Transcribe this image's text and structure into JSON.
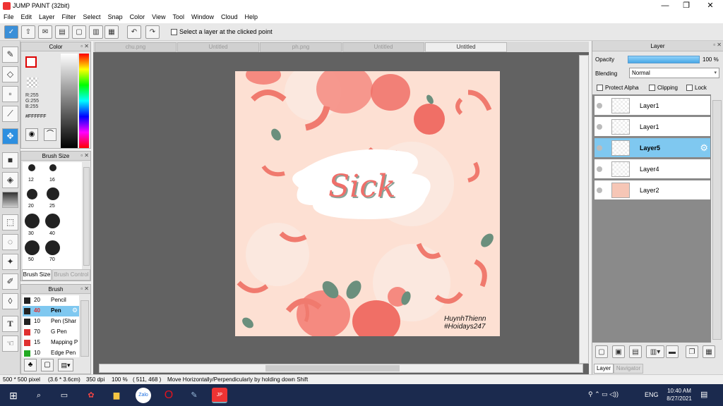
{
  "window": {
    "title": "JUMP PAINT (32bit)",
    "minimize": "—",
    "restore": "❐",
    "close": "✕"
  },
  "menu": [
    "File",
    "Edit",
    "Layer",
    "Filter",
    "Select",
    "Snap",
    "Color",
    "View",
    "Tool",
    "Window",
    "Cloud",
    "Help"
  ],
  "toolbar": {
    "select_layer_label": "Select a layer at the clicked point"
  },
  "color_panel": {
    "title": "Color",
    "r": "R:255",
    "g": "G:255",
    "b": "B:255",
    "hex": "#FFFFFF"
  },
  "brush_size_panel": {
    "title": "Brush Size",
    "sizes": [
      "12",
      "16",
      "20",
      "25",
      "30",
      "40",
      "50",
      "70"
    ],
    "tab_active": "Brush Size",
    "tab_inactive": "Brush Control"
  },
  "brush_panel": {
    "title": "Brush",
    "items": [
      {
        "size": "20",
        "name": "Pencil",
        "color": "#222222"
      },
      {
        "size": "40",
        "name": "Pen",
        "color": "#222222"
      },
      {
        "size": "10",
        "name": "Pen (Shar",
        "color": "#222222"
      },
      {
        "size": "70",
        "name": "G Pen",
        "color": "#e03030"
      },
      {
        "size": "15",
        "name": "Mapping P",
        "color": "#e03030"
      },
      {
        "size": "10",
        "name": "Edge Pen",
        "color": "#22aa22"
      }
    ]
  },
  "tabs": [
    "chu.png",
    "Untitled",
    "ph.png",
    "Untitled",
    "Untitled"
  ],
  "artwork": {
    "headline": "Sick",
    "signature_line1": "HuynhThienn",
    "signature_line2": "#Hoidays247"
  },
  "layer_panel": {
    "title": "Layer",
    "opacity_label": "Opacity",
    "opacity_value": "100 %",
    "blending_label": "Blending",
    "blending_value": "Normal",
    "protect_alpha": "Protect Alpha",
    "clipping": "Clipping",
    "lock": "Lock",
    "layers": [
      "Layer1",
      "Layer1",
      "Layer5",
      "Layer4",
      "Layer2"
    ],
    "tab_layer": "Layer",
    "tab_navigator": "Navigator"
  },
  "status": {
    "size": "500 * 500 pixel",
    "cm": "(3.6 * 3.6cm)",
    "dpi": "350 dpi",
    "zoom": "100 %",
    "coords": "( 511, 468 )",
    "hint": "Move Horizontally/Perpendicularly by holding down Shift"
  },
  "taskbar": {
    "lang": "ENG",
    "time": "10:40 AM",
    "date": "8/27/2021"
  }
}
